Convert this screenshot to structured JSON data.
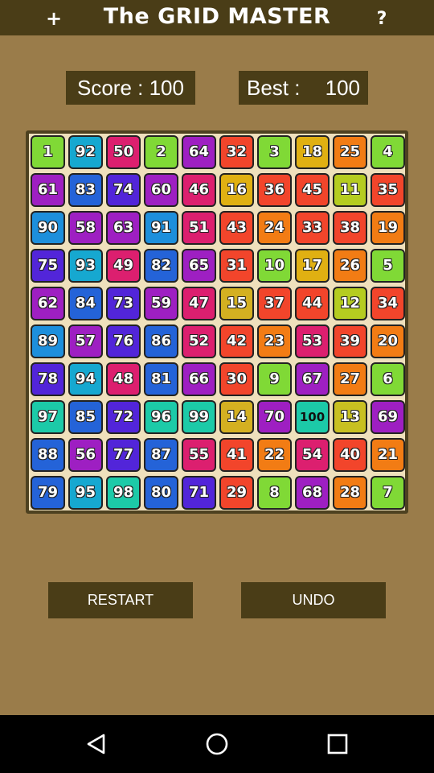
{
  "header": {
    "add_label": "+",
    "title": "The GRID MASTER",
    "help_label": "?"
  },
  "score": {
    "label": "Score : ",
    "value": "100"
  },
  "best": {
    "label": "Best :",
    "value": "100"
  },
  "colors": {
    "1": "#80d936",
    "2": "#80d936",
    "3": "#80d936",
    "4": "#80d936",
    "5": "#80d936",
    "6": "#80d936",
    "7": "#80d936",
    "8": "#80d936",
    "9": "#80d936",
    "10": "#80d936",
    "11": "#b5cc20",
    "12": "#b5cc20",
    "13": "#c8c021",
    "14": "#d4b021",
    "15": "#d4b021",
    "16": "#e0b012",
    "17": "#e0b012",
    "18": "#e0b012",
    "19": "#f27c14",
    "20": "#f27c14",
    "21": "#f27c14",
    "22": "#f27c14",
    "23": "#f27c14",
    "24": "#f27c14",
    "25": "#f27c14",
    "26": "#f27c14",
    "27": "#f27c14",
    "28": "#f27c14",
    "29": "#f2452b",
    "30": "#f2452b",
    "31": "#f2452b",
    "32": "#f2452b",
    "33": "#f2452b",
    "34": "#f2452b",
    "35": "#f2452b",
    "36": "#f2452b",
    "37": "#f2452b",
    "38": "#f2452b",
    "39": "#f2452b",
    "40": "#f2452b",
    "41": "#f2452b",
    "42": "#f2452b",
    "43": "#f2452b",
    "44": "#f2452b",
    "45": "#f2452b",
    "46": "#dc1f6f",
    "47": "#dc1f6f",
    "48": "#dc1f6f",
    "49": "#dc1f6f",
    "50": "#dc1f6f",
    "51": "#dc1f6f",
    "52": "#dc1f6f",
    "53": "#dc1f6f",
    "54": "#dc1f6f",
    "55": "#dc1f6f",
    "56": "#9e1fc2",
    "57": "#9e1fc2",
    "58": "#9e1fc2",
    "59": "#9e1fc2",
    "60": "#9e1fc2",
    "61": "#9e1fc2",
    "62": "#9e1fc2",
    "63": "#9e1fc2",
    "64": "#9e1fc2",
    "65": "#9e1fc2",
    "66": "#9e1fc2",
    "67": "#9e1fc2",
    "68": "#9e1fc2",
    "69": "#9e1fc2",
    "70": "#9e1fc2",
    "71": "#5225d9",
    "72": "#5225d9",
    "73": "#5225d9",
    "74": "#5225d9",
    "75": "#5225d9",
    "76": "#5225d9",
    "77": "#5225d9",
    "78": "#5225d9",
    "79": "#2463d8",
    "80": "#2463d8",
    "81": "#2463d8",
    "82": "#2463d8",
    "83": "#2463d8",
    "84": "#2463d8",
    "85": "#2463d8",
    "86": "#2463d8",
    "87": "#2463d8",
    "88": "#2463d8",
    "89": "#1d8fdc",
    "90": "#1d8fdc",
    "91": "#1d8fdc",
    "92": "#16a8d0",
    "93": "#16a8d0",
    "94": "#16a8d0",
    "95": "#16a8d0",
    "96": "#1ccaa8",
    "97": "#1ccaa8",
    "98": "#1ccaa8",
    "99": "#1ccaa8",
    "100": "#1ccaa8"
  },
  "grid": [
    [
      "1",
      "92",
      "50",
      "2",
      "64",
      "32",
      "3",
      "18",
      "25",
      "4"
    ],
    [
      "61",
      "83",
      "74",
      "60",
      "46",
      "16",
      "36",
      "45",
      "11",
      "35"
    ],
    [
      "90",
      "58",
      "63",
      "91",
      "51",
      "43",
      "24",
      "33",
      "38",
      "19"
    ],
    [
      "75",
      "93",
      "49",
      "82",
      "65",
      "31",
      "10",
      "17",
      "26",
      "5"
    ],
    [
      "62",
      "84",
      "73",
      "59",
      "47",
      "15",
      "37",
      "44",
      "12",
      "34"
    ],
    [
      "89",
      "57",
      "76",
      "86",
      "52",
      "42",
      "23",
      "53",
      "39",
      "20"
    ],
    [
      "78",
      "94",
      "48",
      "81",
      "66",
      "30",
      "9",
      "67",
      "27",
      "6"
    ],
    [
      "97",
      "85",
      "72",
      "96",
      "99",
      "14",
      "70",
      "100",
      "13",
      "69"
    ],
    [
      "88",
      "56",
      "77",
      "87",
      "55",
      "41",
      "22",
      "54",
      "40",
      "21"
    ],
    [
      "79",
      "95",
      "98",
      "80",
      "71",
      "29",
      "8",
      "68",
      "28",
      "7"
    ]
  ],
  "buttons": {
    "restart": "RESTART",
    "undo": "UNDO"
  }
}
